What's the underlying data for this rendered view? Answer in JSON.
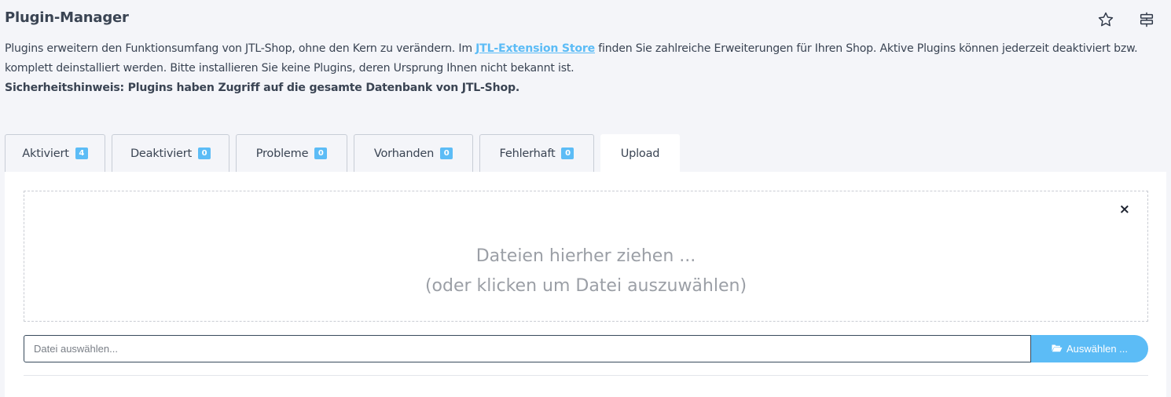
{
  "page": {
    "title": "Plugin-Manager",
    "icons": [
      "star-icon",
      "menu-icon"
    ]
  },
  "description": {
    "text_before_link": "Plugins erweitern den Funktionsumfang von JTL-Shop, ohne den Kern zu verändern. Im ",
    "link_text": "JTL-Extension Store",
    "text_after_link": " finden Sie zahlreiche Erweiterungen für Ihren Shop. Aktive Plugins können jederzeit deaktiviert bzw. komplett deinstalliert werden. Bitte installieren Sie keine Plugins, deren Ursprung Ihnen nicht bekannt ist.",
    "warning": "Sicherheitshinweis: Plugins haben Zugriff auf die gesamte Datenbank von JTL-Shop."
  },
  "tabs": [
    {
      "label": "Aktiviert",
      "count": "4"
    },
    {
      "label": "Deaktiviert",
      "count": "0"
    },
    {
      "label": "Probleme",
      "count": "0"
    },
    {
      "label": "Vorhanden",
      "count": "0"
    },
    {
      "label": "Fehlerhaft",
      "count": "0"
    },
    {
      "label": "Upload",
      "active": true
    }
  ],
  "upload": {
    "close_symbol": "×",
    "drop_line1": "Dateien hierher ziehen ...",
    "drop_line2": "(oder klicken um Datei auszuwählen)",
    "file_placeholder": "Datei auswählen...",
    "pick_button": "Auswählen ...",
    "pick_icon": "folder-open-icon"
  },
  "colors": {
    "accent": "#5cbcf6",
    "text": "#3a4453",
    "background": "#f4f5f9"
  }
}
